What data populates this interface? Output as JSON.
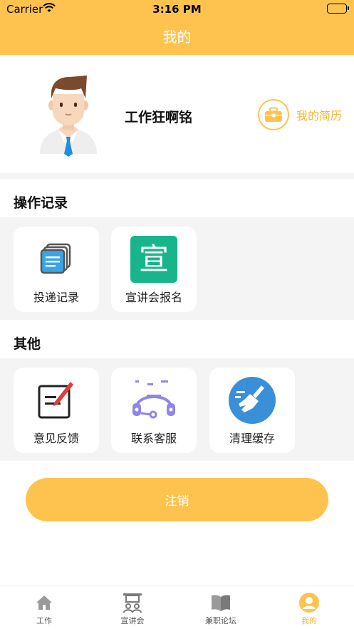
{
  "status_bar": {
    "carrier": "Carrier",
    "time": "3:16 PM"
  },
  "nav": {
    "title": "我的"
  },
  "profile": {
    "username": "工作狂啊铭",
    "resume_label": "我的简历"
  },
  "sections": {
    "records": {
      "title": "操作记录",
      "items": [
        {
          "label": "投递记录",
          "icon": "documents-icon"
        },
        {
          "label": "宣讲会报名",
          "icon": "xuan-badge-icon",
          "badge_char": "宣"
        }
      ]
    },
    "other": {
      "title": "其他",
      "items": [
        {
          "label": "意见反馈",
          "icon": "feedback-edit-icon"
        },
        {
          "label": "联系客服",
          "icon": "headset-icon"
        },
        {
          "label": "清理缓存",
          "icon": "broom-icon"
        }
      ]
    }
  },
  "logout_label": "注销",
  "tabbar": {
    "active_index": 3,
    "tabs": [
      {
        "label": "工作",
        "icon": "home-icon"
      },
      {
        "label": "宣讲会",
        "icon": "seminar-icon"
      },
      {
        "label": "兼职论坛",
        "icon": "book-icon"
      },
      {
        "label": "我的",
        "icon": "user-icon"
      }
    ]
  },
  "colors": {
    "brand": "#fec34e",
    "brand_text": "#f7b733",
    "background_gray": "#f4f4f4",
    "xuan_badge": "#18b58a",
    "broom_circle": "#3a8fd9"
  }
}
